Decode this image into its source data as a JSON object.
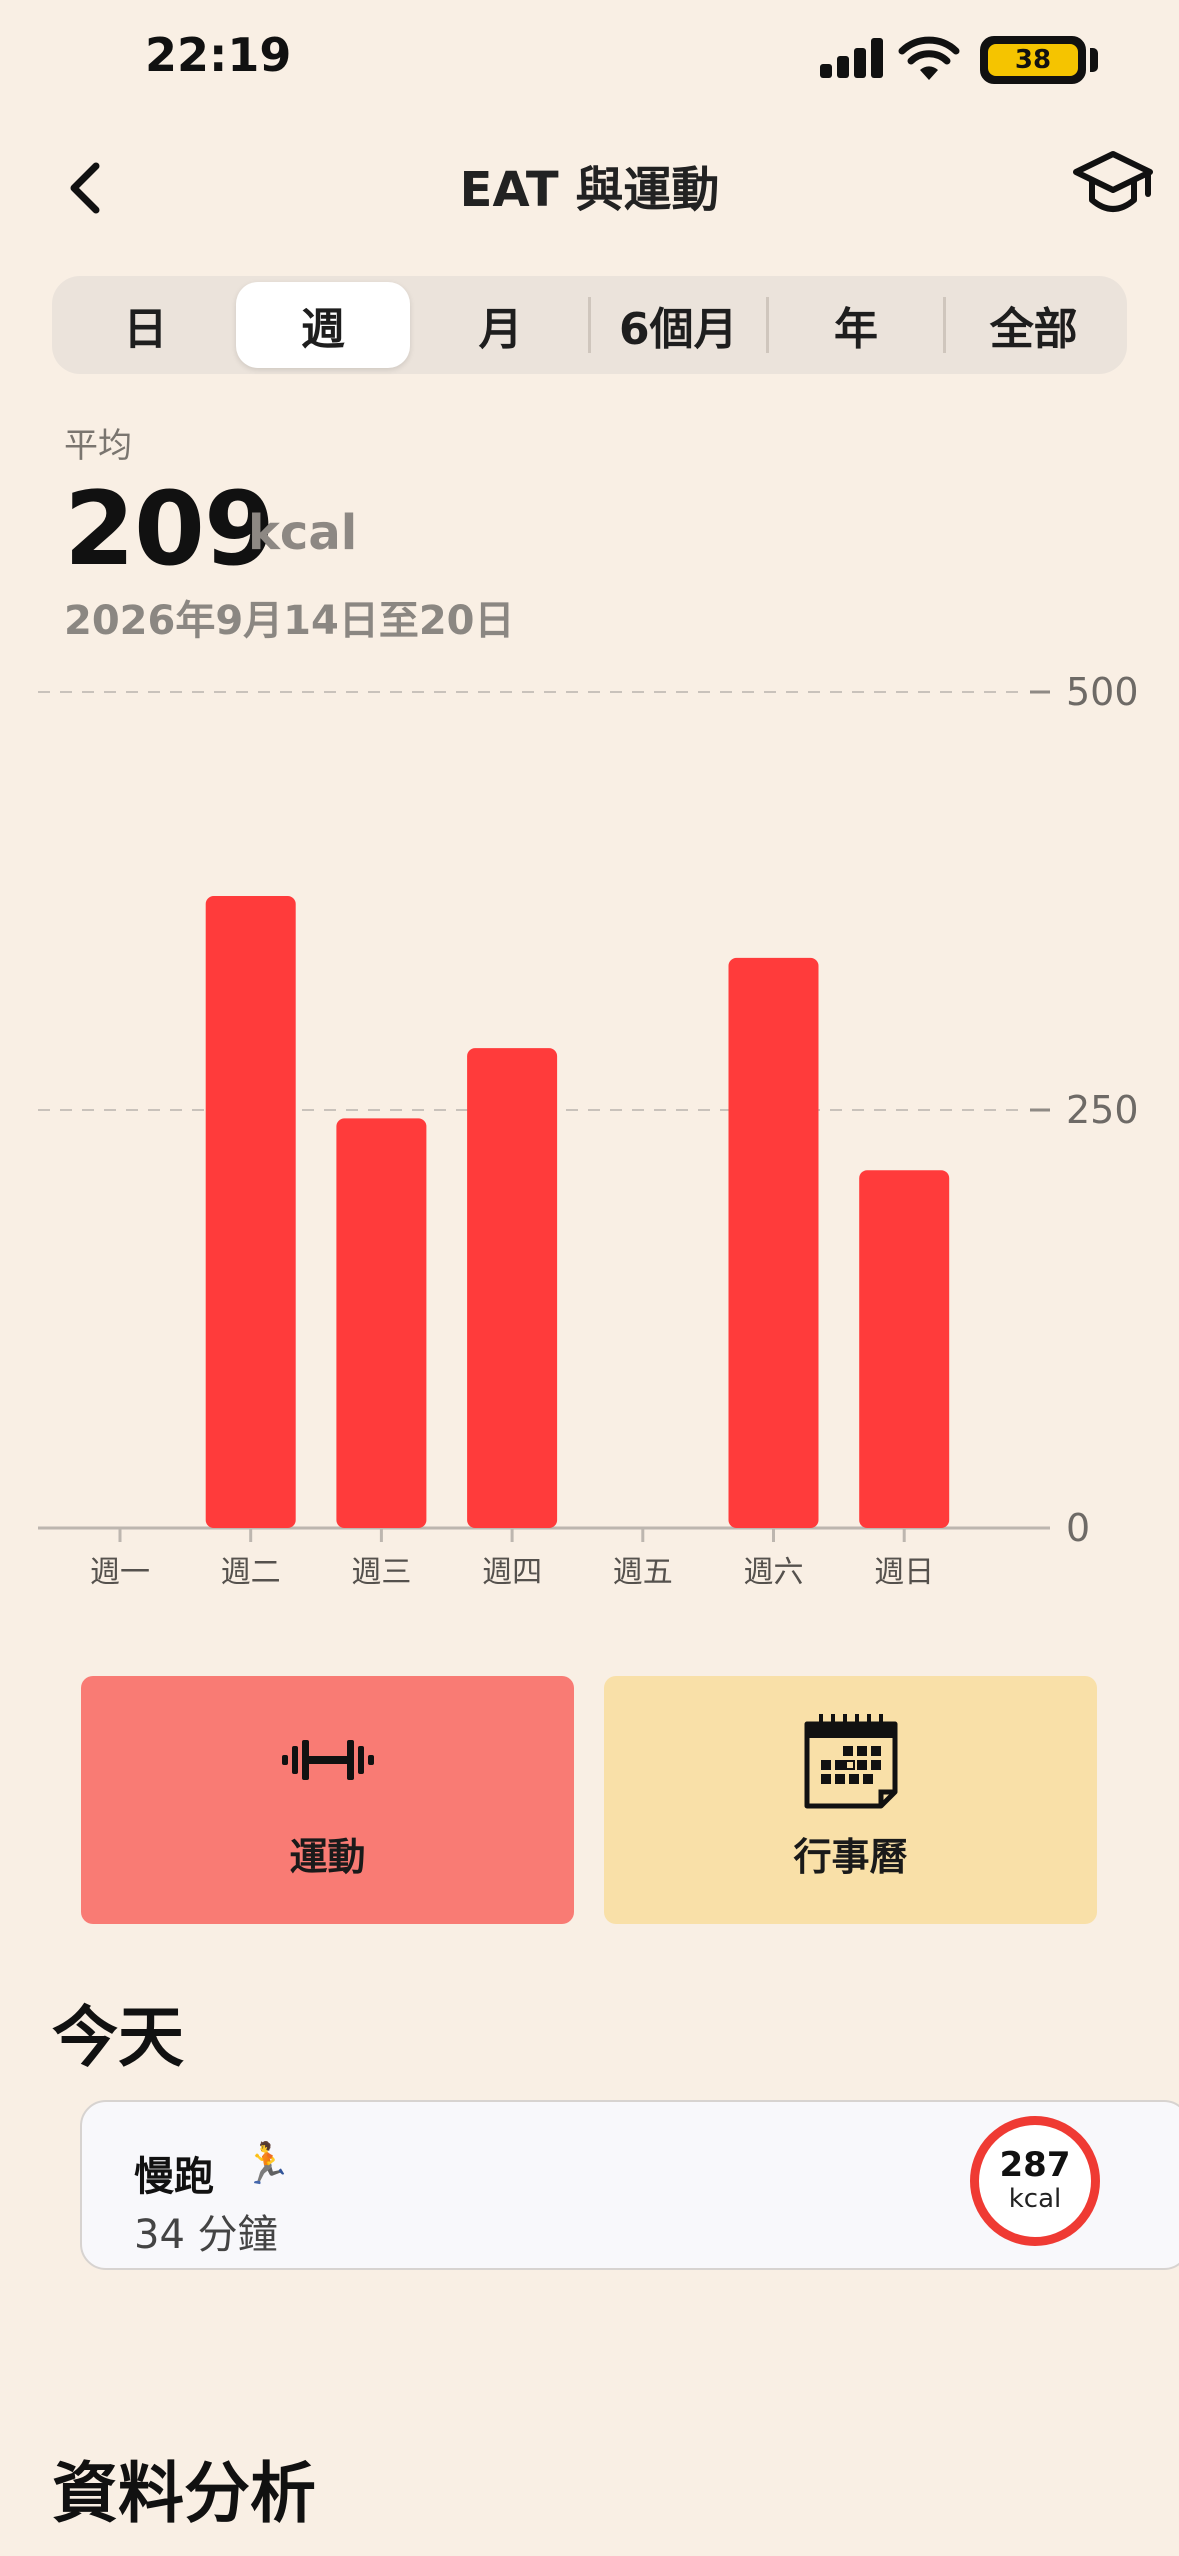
{
  "status_bar": {
    "time": "22:19",
    "battery": "38"
  },
  "nav": {
    "title": "EAT 與運動"
  },
  "segments": [
    {
      "label": "日",
      "active": false
    },
    {
      "label": "週",
      "active": true
    },
    {
      "label": "月",
      "active": false
    },
    {
      "label": "6個月",
      "active": false
    },
    {
      "label": "年",
      "active": false
    },
    {
      "label": "全部",
      "active": false
    }
  ],
  "summary": {
    "avg_label": "平均",
    "avg_value": "209",
    "avg_unit": "kcal",
    "date_range": "2026年9月14日至20日"
  },
  "chart_data": {
    "type": "bar",
    "categories": [
      "週一",
      "週二",
      "週三",
      "週四",
      "週五",
      "週六",
      "週日"
    ],
    "values": [
      0,
      378,
      245,
      287,
      0,
      341,
      214
    ],
    "ylim": [
      0,
      500
    ],
    "yticks": [
      "0",
      "250",
      "500"
    ],
    "bar_color": "#ff3b3b",
    "grid": true
  },
  "actions": {
    "exercise_label": "運動",
    "calendar_label": "行事曆"
  },
  "today": {
    "title": "今天",
    "activity": {
      "name": "慢跑",
      "emoji": "🏃",
      "duration": "34 分鐘",
      "kcal": "287",
      "kcal_unit": "kcal"
    }
  },
  "analysis": {
    "title": "資料分析"
  }
}
